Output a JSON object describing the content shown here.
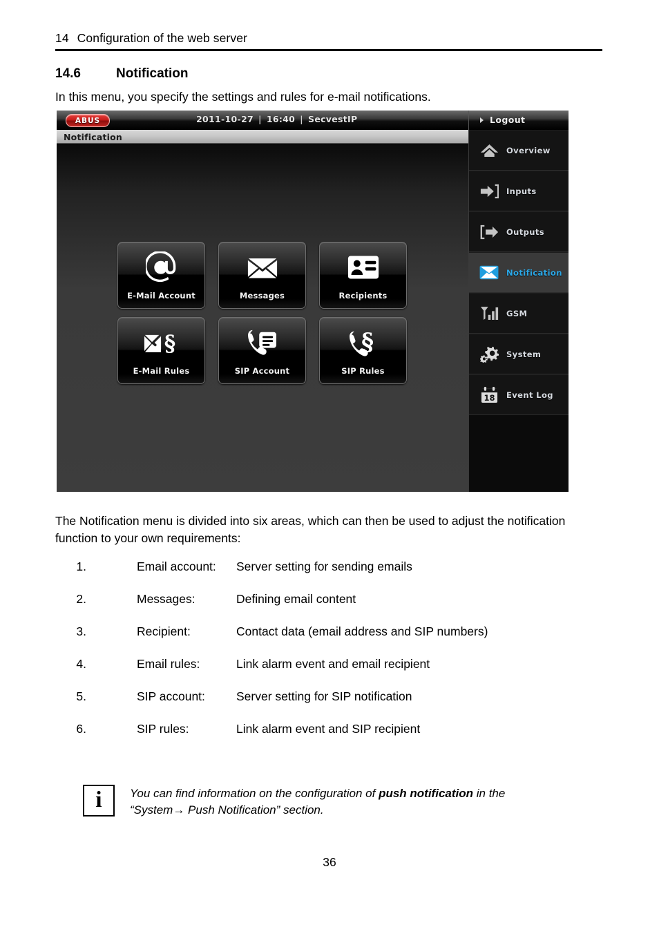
{
  "document": {
    "running_head_number": "14",
    "running_head_title": "Configuration of the web server",
    "section_number": "14.6",
    "section_title": "Notification",
    "intro_paragraph": "In this menu, you specify the settings and rules for e-mail notifications.",
    "body_paragraph": "The Notification menu is divided into six areas, which can then be used to adjust the notification function to your own requirements:",
    "page_number": "36"
  },
  "numbered_list": [
    {
      "index": "1.",
      "term": "Email account:",
      "description": "Server setting for sending emails"
    },
    {
      "index": "2.",
      "term": "Messages:",
      "description": "Defining email content"
    },
    {
      "index": "3.",
      "term": "Recipient:",
      "description": "Contact data (email address and SIP numbers)"
    },
    {
      "index": "4.",
      "term": "Email rules:",
      "description": "Link alarm event and email recipient"
    },
    {
      "index": "5.",
      "term": "SIP account:",
      "description": "Server setting for SIP notification"
    },
    {
      "index": "6.",
      "term": "SIP rules:",
      "description": "Link alarm event and SIP recipient"
    }
  ],
  "note": {
    "icon": "info-icon",
    "line1_prefix": "You can find information on the configuration of ",
    "line1_bold": "push notification",
    "line1_suffix": " in the",
    "line2": "“System→ Push Notification” section."
  },
  "screenshot": {
    "topbar": {
      "logo_text": "ABUS",
      "date": "2011-10-27",
      "time": "16:40",
      "device": "SecvestIP",
      "separator": "|",
      "logout_label": "Logout",
      "logout_icon": "triangle-right-icon"
    },
    "breadcrumb": "Notification",
    "arm_buttons": [
      {
        "name": "partial-arm",
        "icon": "house-lock-icon",
        "active": false
      },
      {
        "name": "disarm",
        "icon": "unlocked-padlock-icon",
        "active": true
      },
      {
        "name": "full-arm",
        "icon": "locked-padlock-icon",
        "active": false
      }
    ],
    "tiles": [
      {
        "label": "E-Mail Account",
        "icon": "at-sign-icon"
      },
      {
        "label": "Messages",
        "icon": "envelope-icon"
      },
      {
        "label": "Recipients",
        "icon": "contact-card-icon"
      },
      {
        "label": "E-Mail Rules",
        "icon": "envelope-paragraph-icon"
      },
      {
        "label": "SIP Account",
        "icon": "phone-list-icon"
      },
      {
        "label": "SIP Rules",
        "icon": "phone-paragraph-icon"
      }
    ],
    "nav_items": [
      {
        "label": "Overview",
        "icon": "home-icon",
        "active": false
      },
      {
        "label": "Inputs",
        "icon": "arrow-in-icon",
        "active": false
      },
      {
        "label": "Outputs",
        "icon": "arrow-out-icon",
        "active": false
      },
      {
        "label": "Notification",
        "icon": "envelope-icon",
        "active": true
      },
      {
        "label": "GSM",
        "icon": "signal-bars-icon",
        "active": false
      },
      {
        "label": "System",
        "icon": "gears-icon",
        "active": false
      },
      {
        "label": "Event Log",
        "icon": "calendar-18-icon",
        "active": false
      }
    ],
    "colors": {
      "accent_blue": "#2aa8e8",
      "logo_red": "#c41a18",
      "panel_dark": "#3d3d3d",
      "nav_dark": "#141414"
    }
  }
}
